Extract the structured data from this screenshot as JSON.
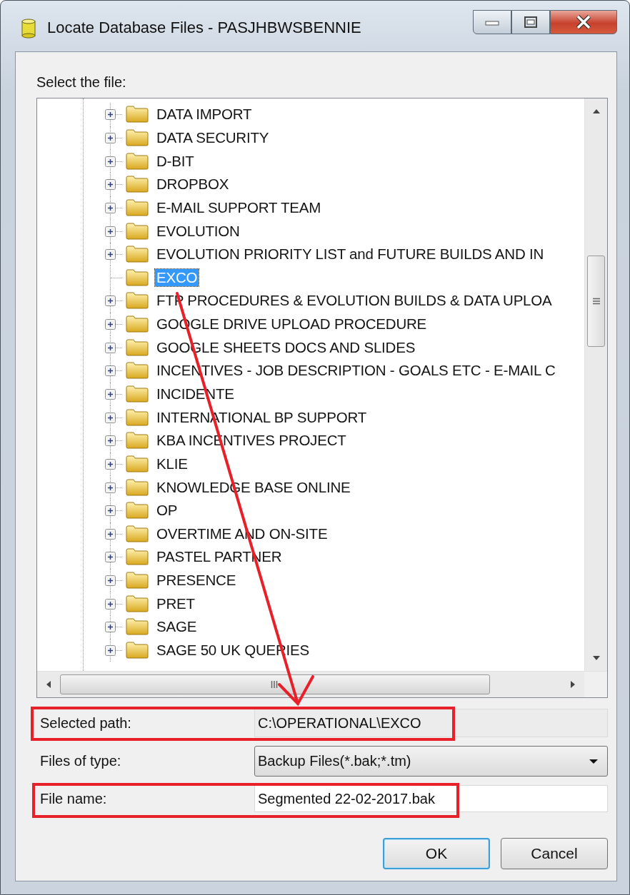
{
  "window": {
    "title": "Locate Database Files - PASJHBWSBENNIE"
  },
  "prompt": "Select the file:",
  "tree": {
    "items": [
      {
        "label": "DATA IMPORT",
        "expandable": true,
        "selected": false
      },
      {
        "label": "DATA SECURITY",
        "expandable": true,
        "selected": false
      },
      {
        "label": "D-BIT",
        "expandable": true,
        "selected": false
      },
      {
        "label": "DROPBOX",
        "expandable": true,
        "selected": false
      },
      {
        "label": "E-MAIL SUPPORT TEAM",
        "expandable": true,
        "selected": false
      },
      {
        "label": "EVOLUTION",
        "expandable": true,
        "selected": false
      },
      {
        "label": "EVOLUTION PRIORITY LIST and FUTURE BUILDS AND IN",
        "expandable": true,
        "selected": false
      },
      {
        "label": "EXCO",
        "expandable": false,
        "selected": true
      },
      {
        "label": "FTP PROCEDURES & EVOLUTION BUILDS & DATA UPLOA",
        "expandable": true,
        "selected": false
      },
      {
        "label": "GOOGLE DRIVE UPLOAD PROCEDURE",
        "expandable": true,
        "selected": false
      },
      {
        "label": "GOOGLE SHEETS DOCS AND SLIDES",
        "expandable": true,
        "selected": false
      },
      {
        "label": "INCENTIVES - JOB DESCRIPTION - GOALS ETC - E-MAIL C",
        "expandable": true,
        "selected": false
      },
      {
        "label": "INCIDENTE",
        "expandable": true,
        "selected": false
      },
      {
        "label": "INTERNATIONAL BP SUPPORT",
        "expandable": true,
        "selected": false
      },
      {
        "label": "KBA INCENTIVES PROJECT",
        "expandable": true,
        "selected": false
      },
      {
        "label": "KLIE",
        "expandable": true,
        "selected": false
      },
      {
        "label": "KNOWLEDGE BASE ONLINE",
        "expandable": true,
        "selected": false
      },
      {
        "label": "OP",
        "expandable": true,
        "selected": false
      },
      {
        "label": "OVERTIME AND ON-SITE",
        "expandable": true,
        "selected": false
      },
      {
        "label": "PASTEL PARTNER",
        "expandable": true,
        "selected": false
      },
      {
        "label": "PRESENCE",
        "expandable": true,
        "selected": false
      },
      {
        "label": "PRET",
        "expandable": true,
        "selected": false
      },
      {
        "label": "SAGE",
        "expandable": true,
        "selected": false
      },
      {
        "label": "SAGE 50 UK QUERIES",
        "expandable": true,
        "selected": false
      }
    ]
  },
  "selected_path": {
    "label": "Selected path:",
    "value": "C:\\OPERATIONAL\\EXCO"
  },
  "file_type": {
    "label": "Files of type:",
    "value": "Backup Files(*.bak;*.tm)"
  },
  "file_name": {
    "label": "File name:",
    "value": "Segmented 22-02-2017.bak"
  },
  "buttons": [
    {
      "label": "OK",
      "default": true
    },
    {
      "label": "Cancel",
      "default": false
    }
  ]
}
